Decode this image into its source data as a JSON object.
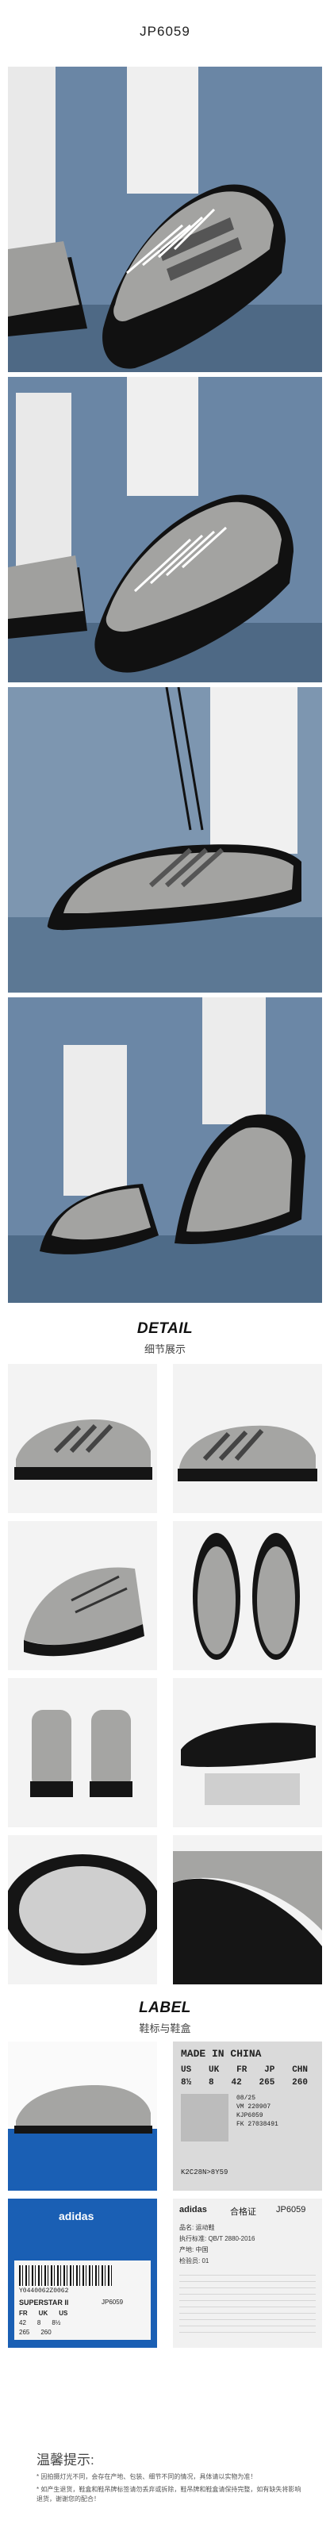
{
  "header": {
    "title": "JP6059"
  },
  "detail_section": {
    "title_en": "DETAIL",
    "title_cn": "细节展示"
  },
  "label_section": {
    "title_en": "LABEL",
    "title_cn": "鞋标与鞋盒"
  },
  "size_tag": {
    "made_in": "MADE IN CHINA",
    "headers": [
      "US",
      "UK",
      "FR",
      "JP",
      "CHN"
    ],
    "values": [
      "8½",
      "8",
      "42",
      "265",
      "260"
    ],
    "lines": [
      "08/25",
      "VM 220907",
      "KJP6059",
      "FK 27038491",
      "K2C28N>8Y59"
    ]
  },
  "box_label": {
    "brand": "adidas",
    "product": "SUPERSTAR II",
    "code": "JP6059",
    "barcode_text": "Y0440062Z0062",
    "sizes_header": [
      "FR",
      "UK",
      "US"
    ],
    "sizes": [
      "42",
      "8",
      "8½"
    ],
    "bottom_values": [
      "265",
      "260"
    ]
  },
  "certificate": {
    "brand": "adidas",
    "title": "合格证",
    "code": "JP6059",
    "lines": [
      "品名: 运动鞋",
      "执行标准: QB/T 2880-2016",
      "产地: 中国",
      "检验员: 01"
    ]
  },
  "tips": {
    "title": "温馨提示:",
    "line1": "* 因拍摄灯光不同，会存在产地、包装、细节不同的情况，具体请以实物为准！",
    "line2": "* 如产生退货，鞋盒和鞋吊牌标签请勿丢弃或拆除，鞋吊牌和鞋盒请保持完整，如有缺失将影响退货，谢谢您的配合！"
  },
  "colors": {
    "sole": "#151515",
    "upper": "#9c9c9a",
    "sky": "#6f88a3",
    "box_blue": "#1a5fb4"
  }
}
